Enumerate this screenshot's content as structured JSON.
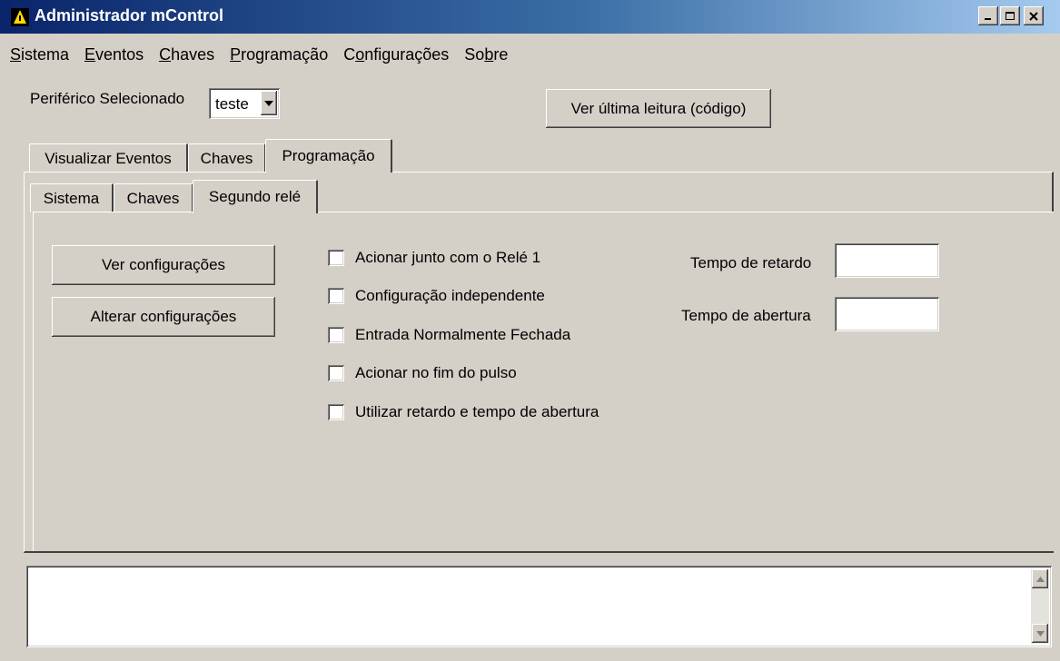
{
  "window": {
    "title": "Administrador mControl"
  },
  "menu": [
    {
      "label": "Sistema",
      "mnemonic": "S",
      "rest": "istema"
    },
    {
      "label": "Eventos",
      "mnemonic": "E",
      "rest": "ventos"
    },
    {
      "label": "Chaves",
      "mnemonic": "C",
      "rest": "haves"
    },
    {
      "label": "Programação",
      "mnemonic": "P",
      "rest": "rogramação"
    },
    {
      "label": "Configurações",
      "pre": "C",
      "mnemonic": "o",
      "rest": "nfigurações"
    },
    {
      "label": "Sobre",
      "pre": "So",
      "mnemonic": "b",
      "rest": "re"
    }
  ],
  "peripheral": {
    "label": "Periférico Selecionado",
    "selected": "teste"
  },
  "last_reading_button": "Ver última leitura (código)",
  "main_tabs": [
    "Visualizar Eventos",
    "Chaves",
    "Programação"
  ],
  "sub_tabs": [
    "Sistema",
    "Chaves",
    "Segundo relé"
  ],
  "actions": {
    "view_config": "Ver configurações",
    "change_config": "Alterar configurações"
  },
  "checkboxes": [
    {
      "label": "Acionar junto com o Relé 1",
      "checked": false
    },
    {
      "label": "Configuração independente",
      "checked": false
    },
    {
      "label": "Entrada Normalmente Fechada",
      "checked": false
    },
    {
      "label": "Acionar no fim do pulso",
      "checked": false
    },
    {
      "label": "Utilizar retardo e tempo de abertura",
      "checked": false
    }
  ],
  "timing": {
    "delay_label": "Tempo de retardo",
    "delay_value": "",
    "open_label": "Tempo de abertura",
    "open_value": ""
  },
  "log_text": ""
}
